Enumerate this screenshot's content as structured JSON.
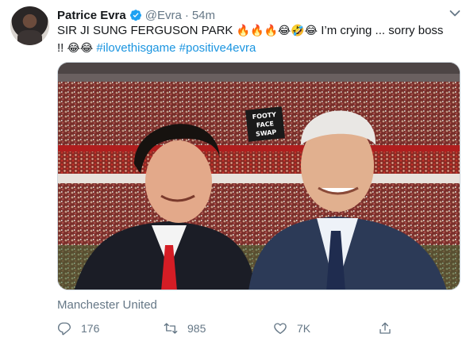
{
  "tweet": {
    "author_name": "Patrice Evra",
    "handle": "@Evra",
    "separator": "·",
    "timestamp": "54m",
    "text_line1_start": "SIR JI SUNG FERGUSON PARK ",
    "text_line1_emoji": "🔥🔥🔥😂🤣😂",
    "text_line1_end": " I’m crying ... sorry boss",
    "text_line2_start": "!! ",
    "text_line2_emoji": "😂😂",
    "hashtags": [
      "#ilovethisgame",
      "#positive4evra"
    ],
    "location": "Manchester United",
    "photo_sign_text": "FOOTY FACE SWAP"
  },
  "actions": {
    "reply_count": "176",
    "retweet_count": "985",
    "like_count": "7K"
  },
  "icons": {
    "verified": "verified-badge-icon",
    "caret": "chevron-down-icon",
    "reply": "reply-icon",
    "retweet": "retweet-icon",
    "like": "heart-icon",
    "share": "share-icon"
  },
  "colors": {
    "text": "#14171a",
    "secondary": "#657786",
    "link": "#1b95e0",
    "verified": "#1da1f2",
    "border": "#ccd6dd"
  }
}
